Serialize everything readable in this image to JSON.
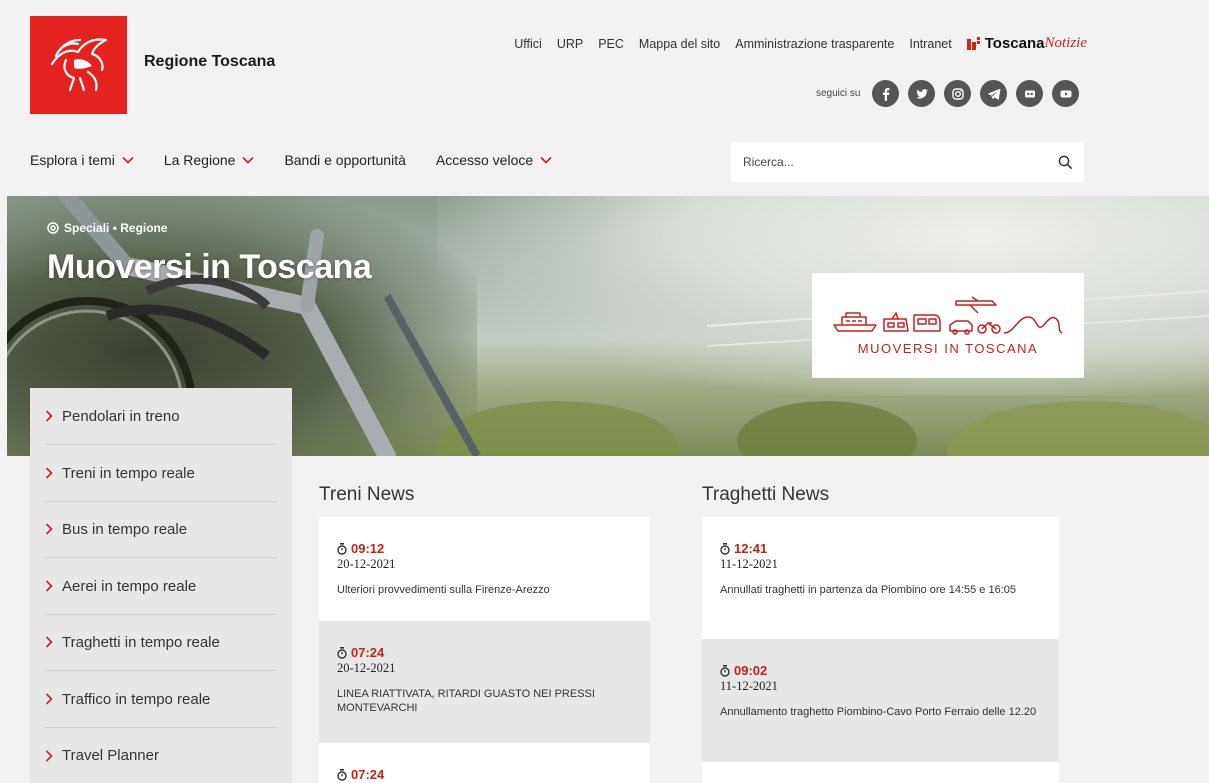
{
  "header": {
    "site_name": "Regione Toscana",
    "top_links": [
      "Uffici",
      "URP",
      "PEC",
      "Mappa del sito",
      "Amministrazione trasparente",
      "Intranet"
    ],
    "toscana_notizie": {
      "bold": "Toscana",
      "italic": "Notizie"
    },
    "social_label": "seguici su",
    "social_icons": [
      "facebook-icon",
      "twitter-icon",
      "instagram-icon",
      "telegram-icon",
      "flickr-icon",
      "youtube-icon"
    ]
  },
  "nav": {
    "items": [
      {
        "label": "Esplora i temi",
        "dropdown": true
      },
      {
        "label": "La Regione",
        "dropdown": true
      },
      {
        "label": "Bandi e opportunità",
        "dropdown": false
      },
      {
        "label": "Accesso veloce",
        "dropdown": true
      }
    ]
  },
  "search": {
    "placeholder": "Ricerca..."
  },
  "hero": {
    "breadcrumb": "Speciali • Regione",
    "title": "Muoversi in Toscana",
    "badge_text": "MUOVERSI IN TOSCANA"
  },
  "side_menu": {
    "items": [
      "Pendolari in treno",
      "Treni in tempo reale",
      "Bus in tempo reale",
      "Aerei in tempo reale",
      "Traghetti in tempo reale",
      "Traffico in tempo reale",
      "Travel Planner"
    ]
  },
  "treni": {
    "title": "Treni News",
    "items": [
      {
        "time": "09:12",
        "date": "20-12-2021",
        "text": "Ulteriori provvedimenti sulla Firenze-Arezzo"
      },
      {
        "time": "07:24",
        "date": "20-12-2021",
        "text": "LINEA RIATTIVATA, RITARDI GUASTO NEI PRESSI MONTEVARCHI"
      },
      {
        "time": "07:24",
        "date": "",
        "text": ""
      }
    ]
  },
  "traghetti": {
    "title": "Traghetti News",
    "items": [
      {
        "time": "12:41",
        "date": "11-12-2021",
        "text": "Annullati traghetti in partenza da Piombino ore 14:55 e 16:05"
      },
      {
        "time": "09:02",
        "date": "11-12-2021",
        "text": "Annullamento traghetto Piombino-Cavo Porto Ferraio delle 12.20"
      }
    ]
  },
  "colors": {
    "brand_red": "#e42321",
    "accent_red": "#c8201d",
    "icon_grey": "#555555"
  }
}
